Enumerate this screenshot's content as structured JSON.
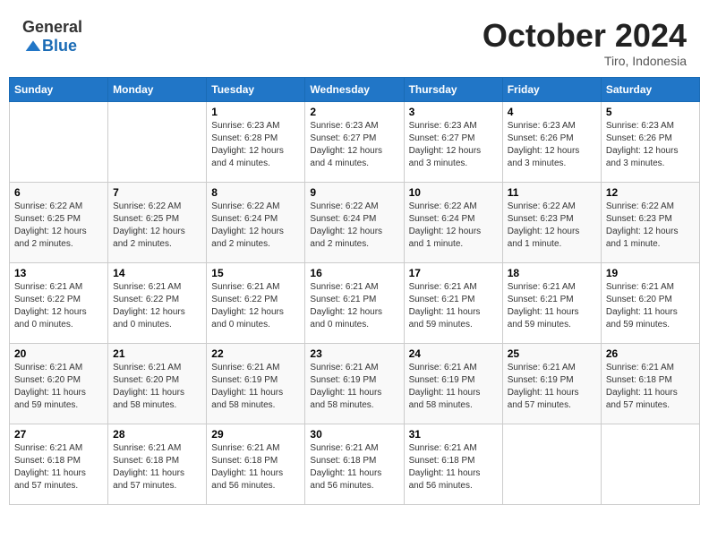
{
  "header": {
    "logo_general": "General",
    "logo_blue": "Blue",
    "month_title": "October 2024",
    "location": "Tiro, Indonesia"
  },
  "days_of_week": [
    "Sunday",
    "Monday",
    "Tuesday",
    "Wednesday",
    "Thursday",
    "Friday",
    "Saturday"
  ],
  "weeks": [
    [
      {
        "day": "",
        "info": ""
      },
      {
        "day": "",
        "info": ""
      },
      {
        "day": "1",
        "info": "Sunrise: 6:23 AM\nSunset: 6:28 PM\nDaylight: 12 hours and 4 minutes."
      },
      {
        "day": "2",
        "info": "Sunrise: 6:23 AM\nSunset: 6:27 PM\nDaylight: 12 hours and 4 minutes."
      },
      {
        "day": "3",
        "info": "Sunrise: 6:23 AM\nSunset: 6:27 PM\nDaylight: 12 hours and 3 minutes."
      },
      {
        "day": "4",
        "info": "Sunrise: 6:23 AM\nSunset: 6:26 PM\nDaylight: 12 hours and 3 minutes."
      },
      {
        "day": "5",
        "info": "Sunrise: 6:23 AM\nSunset: 6:26 PM\nDaylight: 12 hours and 3 minutes."
      }
    ],
    [
      {
        "day": "6",
        "info": "Sunrise: 6:22 AM\nSunset: 6:25 PM\nDaylight: 12 hours and 2 minutes."
      },
      {
        "day": "7",
        "info": "Sunrise: 6:22 AM\nSunset: 6:25 PM\nDaylight: 12 hours and 2 minutes."
      },
      {
        "day": "8",
        "info": "Sunrise: 6:22 AM\nSunset: 6:24 PM\nDaylight: 12 hours and 2 minutes."
      },
      {
        "day": "9",
        "info": "Sunrise: 6:22 AM\nSunset: 6:24 PM\nDaylight: 12 hours and 2 minutes."
      },
      {
        "day": "10",
        "info": "Sunrise: 6:22 AM\nSunset: 6:24 PM\nDaylight: 12 hours and 1 minute."
      },
      {
        "day": "11",
        "info": "Sunrise: 6:22 AM\nSunset: 6:23 PM\nDaylight: 12 hours and 1 minute."
      },
      {
        "day": "12",
        "info": "Sunrise: 6:22 AM\nSunset: 6:23 PM\nDaylight: 12 hours and 1 minute."
      }
    ],
    [
      {
        "day": "13",
        "info": "Sunrise: 6:21 AM\nSunset: 6:22 PM\nDaylight: 12 hours and 0 minutes."
      },
      {
        "day": "14",
        "info": "Sunrise: 6:21 AM\nSunset: 6:22 PM\nDaylight: 12 hours and 0 minutes."
      },
      {
        "day": "15",
        "info": "Sunrise: 6:21 AM\nSunset: 6:22 PM\nDaylight: 12 hours and 0 minutes."
      },
      {
        "day": "16",
        "info": "Sunrise: 6:21 AM\nSunset: 6:21 PM\nDaylight: 12 hours and 0 minutes."
      },
      {
        "day": "17",
        "info": "Sunrise: 6:21 AM\nSunset: 6:21 PM\nDaylight: 11 hours and 59 minutes."
      },
      {
        "day": "18",
        "info": "Sunrise: 6:21 AM\nSunset: 6:21 PM\nDaylight: 11 hours and 59 minutes."
      },
      {
        "day": "19",
        "info": "Sunrise: 6:21 AM\nSunset: 6:20 PM\nDaylight: 11 hours and 59 minutes."
      }
    ],
    [
      {
        "day": "20",
        "info": "Sunrise: 6:21 AM\nSunset: 6:20 PM\nDaylight: 11 hours and 59 minutes."
      },
      {
        "day": "21",
        "info": "Sunrise: 6:21 AM\nSunset: 6:20 PM\nDaylight: 11 hours and 58 minutes."
      },
      {
        "day": "22",
        "info": "Sunrise: 6:21 AM\nSunset: 6:19 PM\nDaylight: 11 hours and 58 minutes."
      },
      {
        "day": "23",
        "info": "Sunrise: 6:21 AM\nSunset: 6:19 PM\nDaylight: 11 hours and 58 minutes."
      },
      {
        "day": "24",
        "info": "Sunrise: 6:21 AM\nSunset: 6:19 PM\nDaylight: 11 hours and 58 minutes."
      },
      {
        "day": "25",
        "info": "Sunrise: 6:21 AM\nSunset: 6:19 PM\nDaylight: 11 hours and 57 minutes."
      },
      {
        "day": "26",
        "info": "Sunrise: 6:21 AM\nSunset: 6:18 PM\nDaylight: 11 hours and 57 minutes."
      }
    ],
    [
      {
        "day": "27",
        "info": "Sunrise: 6:21 AM\nSunset: 6:18 PM\nDaylight: 11 hours and 57 minutes."
      },
      {
        "day": "28",
        "info": "Sunrise: 6:21 AM\nSunset: 6:18 PM\nDaylight: 11 hours and 57 minutes."
      },
      {
        "day": "29",
        "info": "Sunrise: 6:21 AM\nSunset: 6:18 PM\nDaylight: 11 hours and 56 minutes."
      },
      {
        "day": "30",
        "info": "Sunrise: 6:21 AM\nSunset: 6:18 PM\nDaylight: 11 hours and 56 minutes."
      },
      {
        "day": "31",
        "info": "Sunrise: 6:21 AM\nSunset: 6:18 PM\nDaylight: 11 hours and 56 minutes."
      },
      {
        "day": "",
        "info": ""
      },
      {
        "day": "",
        "info": ""
      }
    ]
  ]
}
